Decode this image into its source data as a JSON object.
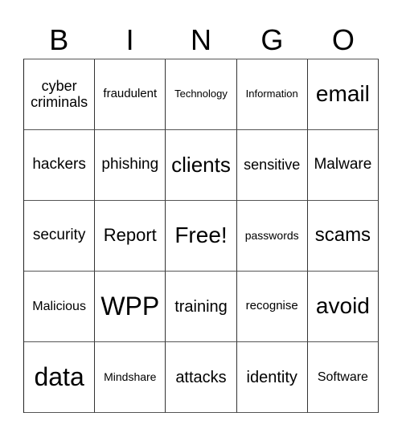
{
  "header": [
    "B",
    "I",
    "N",
    "G",
    "O"
  ],
  "cells": [
    [
      "cyber criminals",
      "fraudulent",
      "Technology",
      "Information",
      "email"
    ],
    [
      "hackers",
      "phishing",
      "clients",
      "sensitive",
      "Malware"
    ],
    [
      "security",
      "Report",
      "Free!",
      "passwords",
      "scams"
    ],
    [
      "Malicious",
      "WPP",
      "training",
      "recognise",
      "avoid"
    ],
    [
      "data",
      "Mindshare",
      "attacks",
      "identity",
      "Software"
    ]
  ]
}
